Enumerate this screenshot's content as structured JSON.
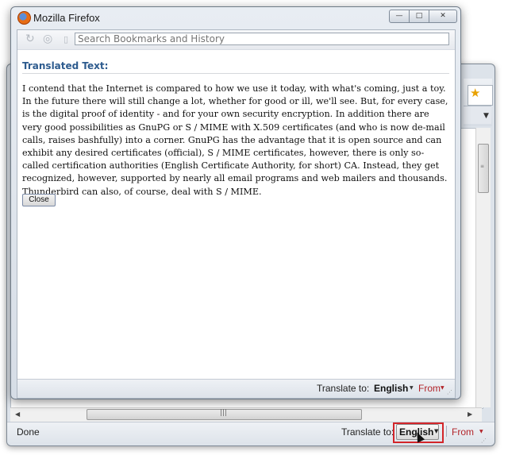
{
  "popup": {
    "title": "Mozilla Firefox",
    "controls": {
      "minimize": "—",
      "maximize": "□",
      "close": "✕"
    },
    "search": {
      "placeholder": "Search Bookmarks and History"
    },
    "heading": "Translated Text:",
    "translated_text": "I contend that the Internet is compared to how we use it today, with what's coming, just a toy. In the future there will still change a lot, whether for good or ill, we'll see. But, for every case, is the digital proof of identity - and for your own security encryption. In addition there are very good possibilities as GnuPG or S / MIME with X.509 certificates (and who is now de-mail calls, raises bashfully) into a corner. GnuPG has the advantage that it is open source and can exhibit any desired certificates (official), S / MIME certificates, however, there is only so-called certification authorities (English Certificate Authority, for short) CA. Instead, they get recognized, however, supported by nearly all email programs and web mailers and thousands. Thunderbird can also, of course, deal with S / MIME.",
    "close_button": "Close",
    "statusbar": {
      "translate_label": "Translate to:",
      "language": "English",
      "from_label": "From"
    }
  },
  "main_window": {
    "status_text": "Done",
    "statusbar": {
      "translate_label": "Translate to:",
      "language": "English",
      "from_label": "From"
    }
  },
  "icons": {
    "reload": "reload-icon",
    "stop": "stop-icon",
    "page": "page-icon",
    "bookmark_star": "star-icon",
    "firefox": "firefox-logo-icon"
  },
  "colors": {
    "heading": "#2d5b8e",
    "from_link": "#b2242a",
    "highlight_box": "#d3262a"
  }
}
